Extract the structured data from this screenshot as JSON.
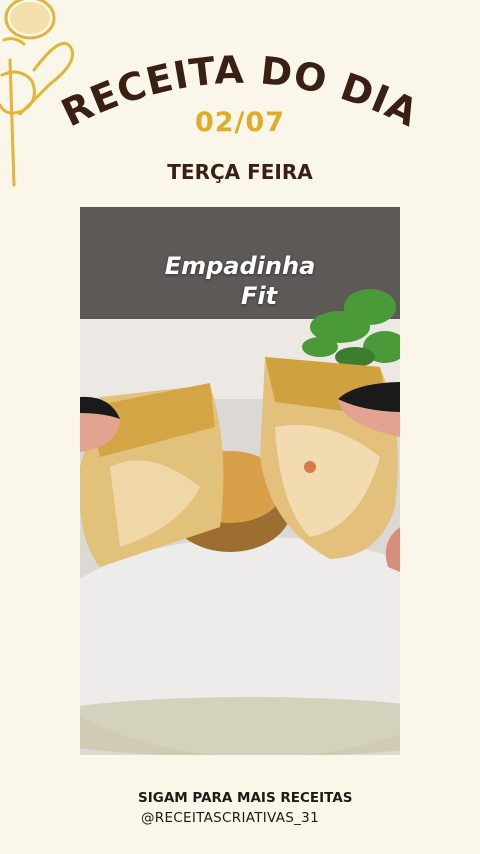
{
  "header": {
    "title": "RECEITA DO DIA",
    "date": "02/07",
    "weekday": "TERÇA FEIRA"
  },
  "photo": {
    "overlay_line1": "Empadinha",
    "overlay_line2": "Fit"
  },
  "footer": {
    "cta": "SIGAM PARA MAIS RECEITAS",
    "handle": "@RECEITASCRIATIVAS_31"
  },
  "icons": [
    "utensils-icon"
  ],
  "colors": {
    "background": "#fbf6ea",
    "title": "#3a1f13",
    "accent": "#e0ad2a"
  }
}
